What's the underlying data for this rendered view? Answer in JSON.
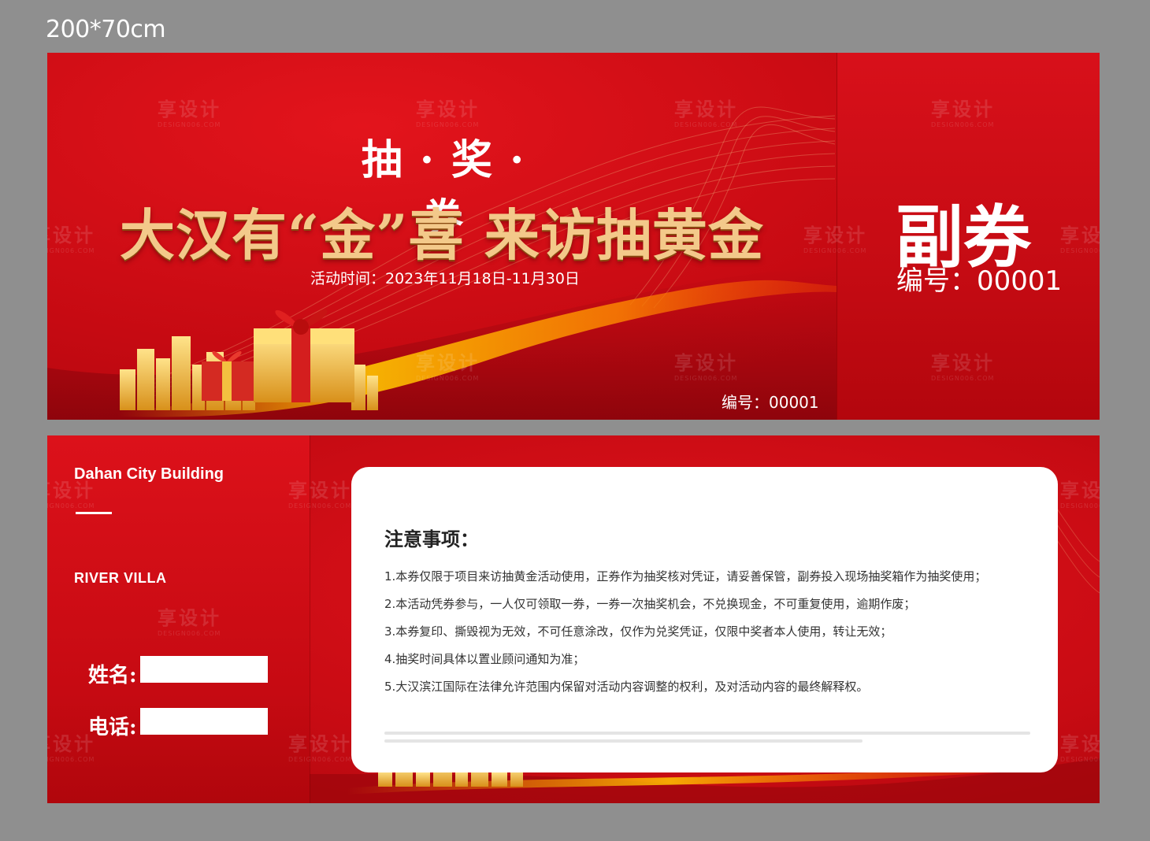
{
  "size_label": "200*70cm",
  "front": {
    "title": "抽 · 奖 · 券",
    "headline": "大汉有“金”喜 来访抽黄金",
    "date": "活动时间：2023年11月18日-11月30日",
    "serial": "编号：00001",
    "colors": {
      "red": "#c60a12",
      "gold": "#f3c98a"
    }
  },
  "stub": {
    "title": "副券",
    "serial": "编号：00001"
  },
  "back": {
    "brand_name": "Dahan City Building",
    "project_name": "RIVER VILLA",
    "name_label": "姓名:",
    "phone_label": "电话:",
    "notice_title": "注意事项：",
    "notices": [
      "1.本券仅限于项目来访抽黄金活动使用，正券作为抽奖核对凭证，请妥善保管，副券投入现场抽奖箱作为抽奖使用；",
      "2.本活动凭券参与，一人仅可领取一券，一券一次抽奖机会，不兑换现金，不可重复使用，逾期作废；",
      "3.本券复印、撕毁视为无效，不可任意涂改，仅作为兑奖凭证，仅限中奖者本人使用，转让无效；",
      "4.抽奖时间具体以置业顾问通知为准；",
      "5.大汉滨江国际在法律允许范围内保留对活动内容调整的权利，及对活动内容的最终解释权。"
    ]
  },
  "watermark": {
    "text": "享设计",
    "sub": "DESIGN006.COM"
  }
}
